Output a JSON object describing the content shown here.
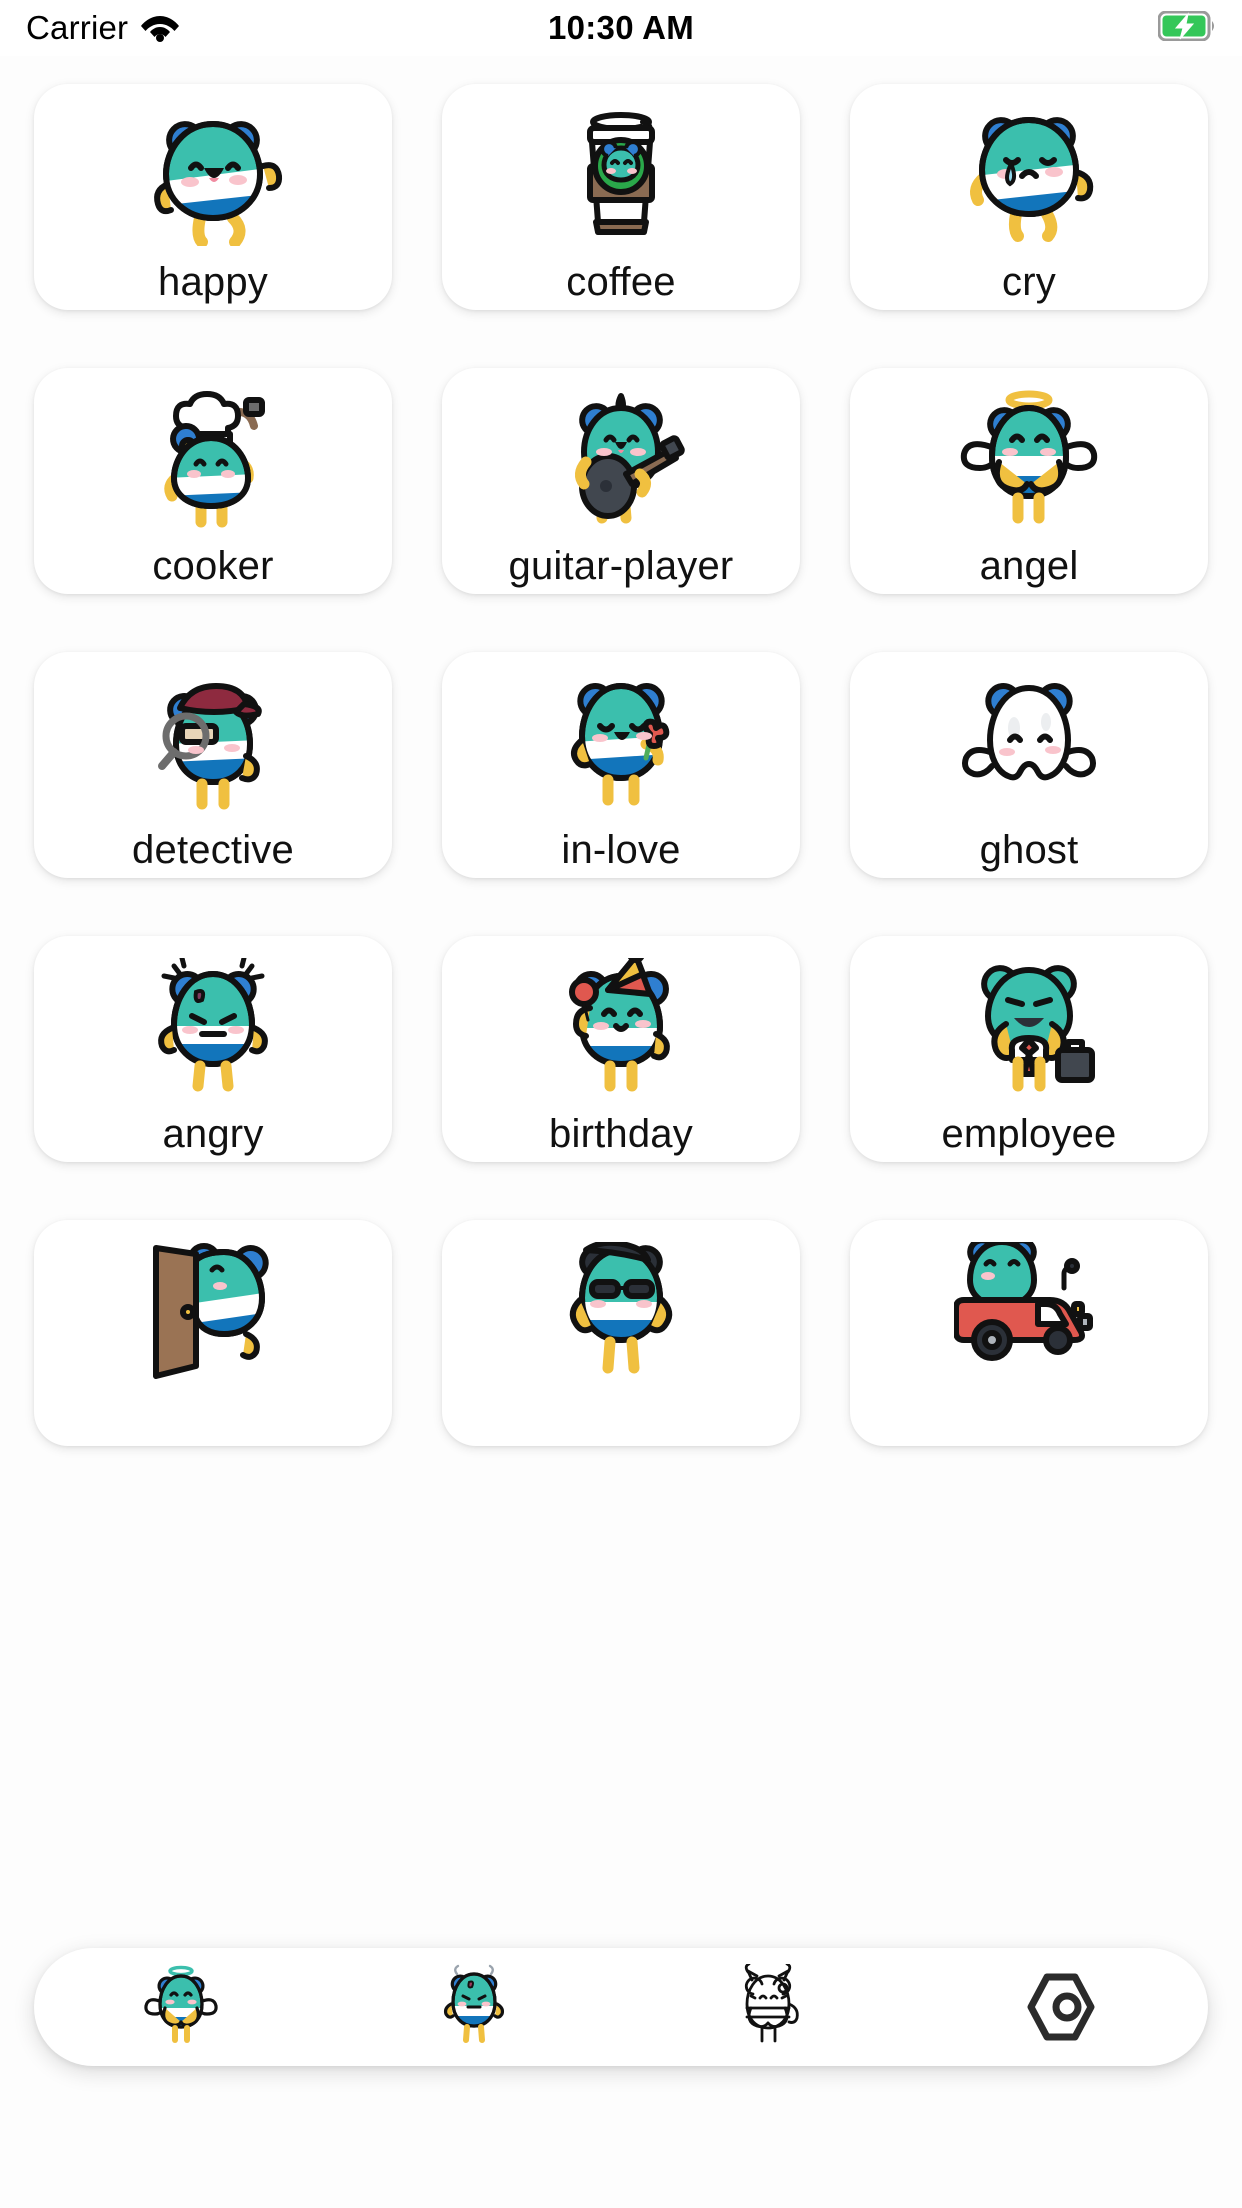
{
  "status_bar": {
    "carrier": "Carrier",
    "wifi_icon": "wifi-icon",
    "time": "10:30 AM",
    "battery_icon": "battery-charging-icon",
    "battery_color": "#34c759"
  },
  "theme": {
    "background": "#fdfdfd",
    "card_background": "#ffffff",
    "text": "#111111",
    "mascot_teal": "#3bbfad",
    "mascot_blue": "#1275bb",
    "mascot_white": "#ffffff",
    "mascot_yellow": "#f5c council",
    "outline": "#000000"
  },
  "grid": {
    "columns": 3,
    "items": [
      {
        "label": "happy",
        "icon": "mascot-happy-icon"
      },
      {
        "label": "coffee",
        "icon": "coffee-cup-icon"
      },
      {
        "label": "cry",
        "icon": "mascot-cry-icon"
      },
      {
        "label": "cooker",
        "icon": "mascot-cooker-icon"
      },
      {
        "label": "guitar-player",
        "icon": "mascot-guitar-player-icon"
      },
      {
        "label": "angel",
        "icon": "mascot-angel-icon"
      },
      {
        "label": "detective",
        "icon": "mascot-detective-icon"
      },
      {
        "label": "in-love",
        "icon": "mascot-in-love-icon"
      },
      {
        "label": "ghost",
        "icon": "mascot-ghost-icon"
      },
      {
        "label": "angry",
        "icon": "mascot-angry-icon"
      },
      {
        "label": "birthday",
        "icon": "mascot-birthday-icon"
      },
      {
        "label": "employee",
        "icon": "mascot-employee-icon"
      },
      {
        "label": "",
        "icon": "mascot-door-icon"
      },
      {
        "label": "",
        "icon": "mascot-cool-icon"
      },
      {
        "label": "",
        "icon": "mascot-car-icon"
      }
    ]
  },
  "tabbar": {
    "items": [
      {
        "name": "tab-angel",
        "icon": "mascot-angel-tab-icon",
        "selected": true
      },
      {
        "name": "tab-angry",
        "icon": "mascot-angry-tab-icon",
        "selected": true
      },
      {
        "name": "tab-devil",
        "icon": "mascot-devil-outline-tab-icon",
        "selected": false
      },
      {
        "name": "tab-settings",
        "icon": "hexagon-nut-icon",
        "selected": false
      }
    ]
  }
}
